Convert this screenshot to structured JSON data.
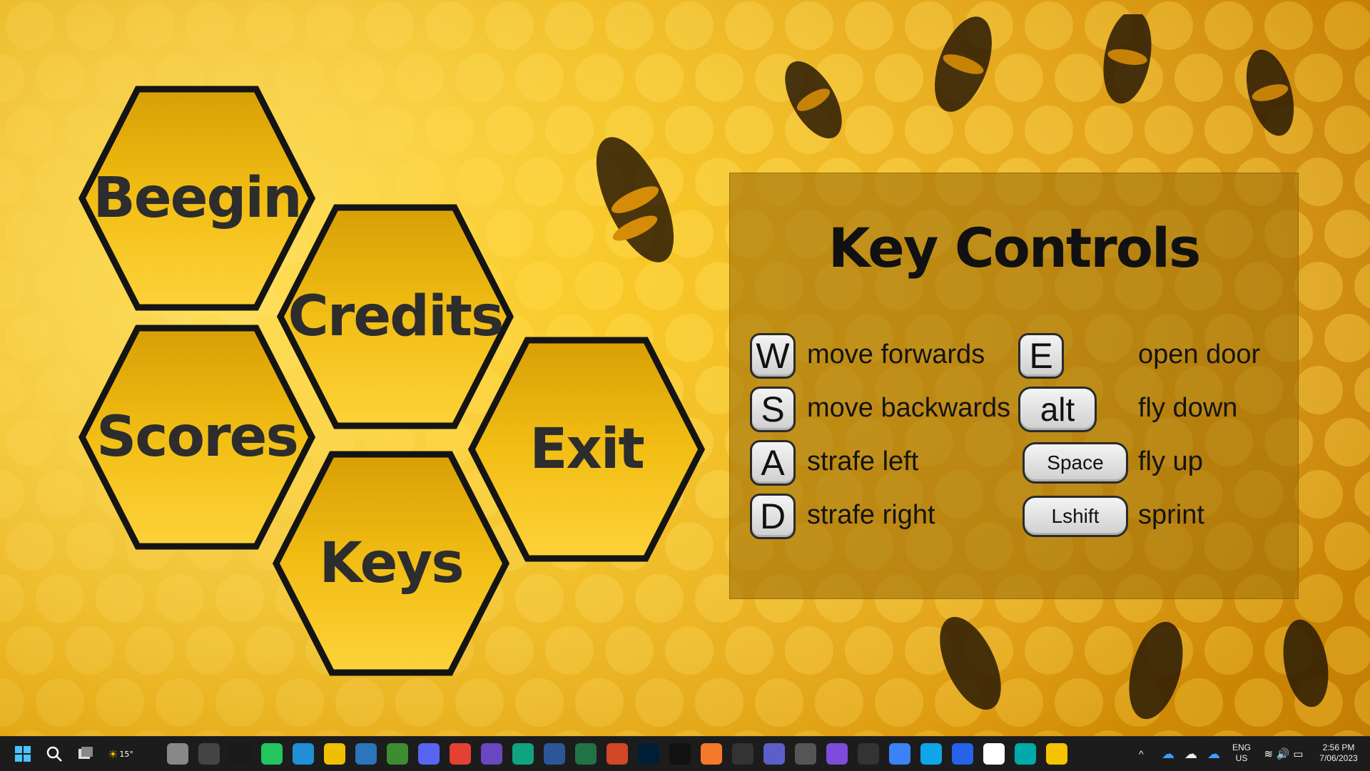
{
  "menu": {
    "buttons": [
      {
        "id": "beegin",
        "label": "Beegin"
      },
      {
        "id": "credits",
        "label": "Credits"
      },
      {
        "id": "scores",
        "label": "Scores"
      },
      {
        "id": "exit",
        "label": "Exit"
      },
      {
        "id": "keys",
        "label": "Keys"
      }
    ]
  },
  "key_controls": {
    "title": "Key Controls",
    "left": [
      {
        "key": "W",
        "action": "move forwards"
      },
      {
        "key": "S",
        "action": "move backwards"
      },
      {
        "key": "A",
        "action": "strafe left"
      },
      {
        "key": "D",
        "action": "strafe right"
      }
    ],
    "right": [
      {
        "key": "E",
        "action": "open door"
      },
      {
        "key": "alt",
        "action": "fly down"
      },
      {
        "key": "Space",
        "action": "fly up"
      },
      {
        "key": "Lshift",
        "action": "sprint"
      }
    ]
  },
  "taskbar": {
    "weather_temp": "15°",
    "language": "ENG",
    "region": "US",
    "time": "2:56 PM",
    "date": "7/06/2023",
    "icons": [
      "windows-start-icon",
      "search-icon",
      "task-view-icon",
      "weather-icon",
      "app-icon",
      "app-icon",
      "app-icon",
      "pycharm-icon",
      "globe-icon",
      "file-explorer-icon",
      "steam-icon",
      "minecraft-icon",
      "discord-icon",
      "chrome-icon",
      "app-icon",
      "chatgpt-icon",
      "word-icon",
      "excel-icon",
      "powerpoint-icon",
      "photoshop-icon",
      "oculus-icon",
      "blender-icon",
      "en-icon",
      "teams-icon",
      "unity-icon",
      "visual-studio-icon",
      "terminal-icon",
      "box-icon",
      "app-icon",
      "app-icon",
      "snipping-tool-icon",
      "app-icon",
      "game-icon"
    ]
  },
  "colors": {
    "hex_fill": "#e8b00c",
    "hex_stroke": "#141414",
    "panel": "#a07008",
    "label": "#2d2d2d"
  }
}
